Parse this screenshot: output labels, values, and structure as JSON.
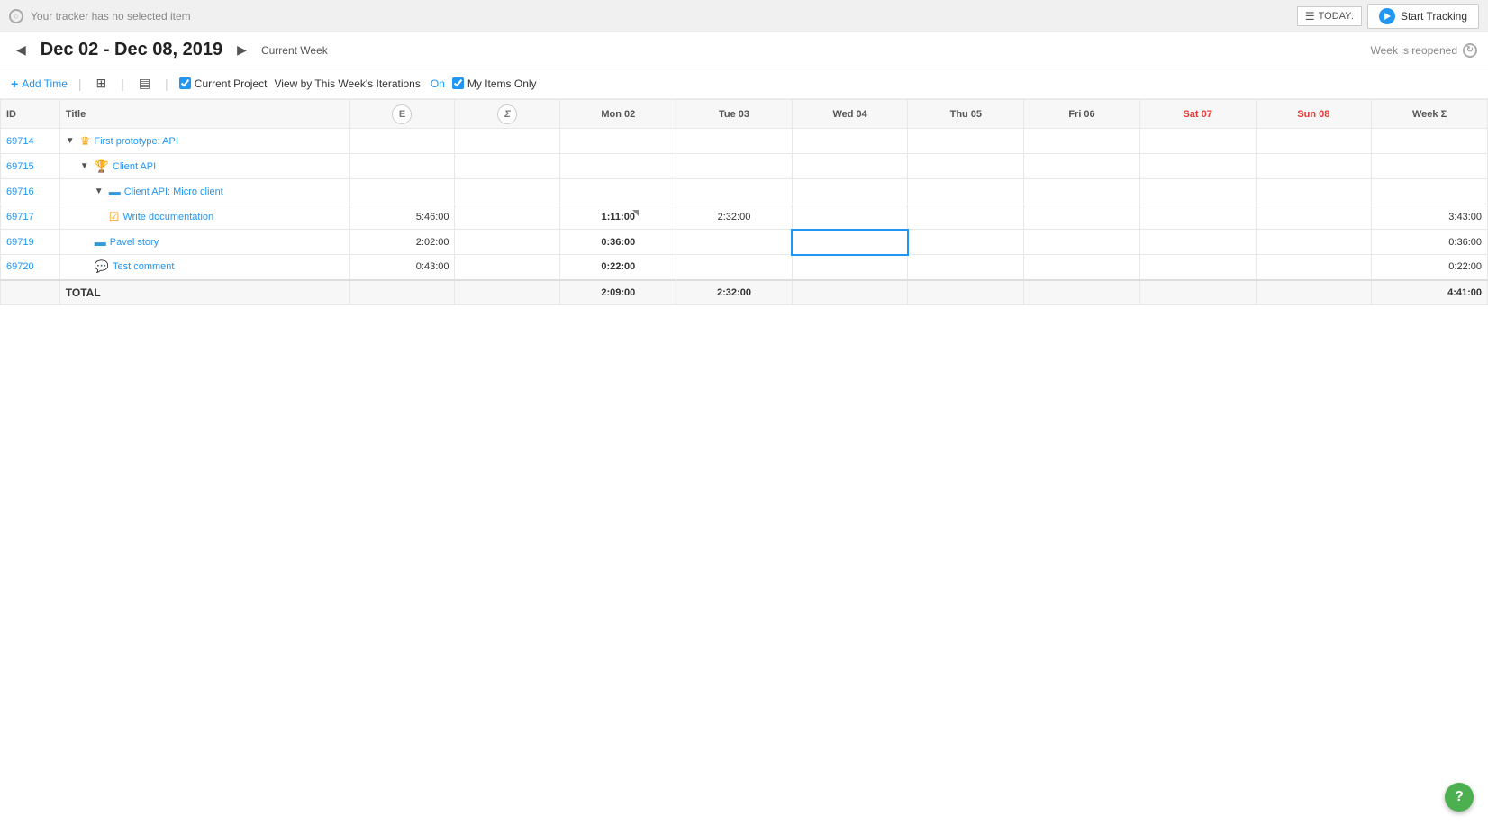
{
  "topBar": {
    "trackerMessage": "Your tracker has no selected item",
    "todayLabel": "TODAY:",
    "startTrackingLabel": "Start Tracking"
  },
  "weekNav": {
    "dateRange": "Dec 02 - Dec 08, 2019",
    "currentWeekLabel": "Current Week",
    "weekReopenedLabel": "Week is reopened"
  },
  "toolbar": {
    "addTimeLabel": "Add Time",
    "currentProjectLabel": "Current Project",
    "viewByLabel": "View by This Week's Iterations",
    "viewByOnLabel": "On",
    "myItemsOnlyLabel": "My Items Only"
  },
  "table": {
    "headers": {
      "id": "ID",
      "title": "Title",
      "e": "E",
      "sigma": "Σ",
      "mon": "Mon 02",
      "tue": "Tue 03",
      "wed": "Wed 04",
      "thu": "Thu 05",
      "fri": "Fri 06",
      "sat": "Sat 07",
      "sun": "Sun 08",
      "weekSigma": "Week Σ"
    },
    "rows": [
      {
        "id": "69714",
        "title": "First prototype: API",
        "icon": "crown",
        "indent": 0,
        "expanded": true,
        "e": "",
        "sigma": "",
        "mon": "",
        "tue": "",
        "wed": "",
        "thu": "",
        "fri": "",
        "sat": "",
        "sun": "",
        "weekSigma": ""
      },
      {
        "id": "69715",
        "title": "Client API",
        "icon": "trophy",
        "indent": 1,
        "expanded": true,
        "e": "",
        "sigma": "",
        "mon": "",
        "tue": "",
        "wed": "",
        "thu": "",
        "fri": "",
        "sat": "",
        "sun": "",
        "weekSigma": ""
      },
      {
        "id": "69716",
        "title": "Client API: Micro client",
        "icon": "story",
        "indent": 2,
        "expanded": true,
        "e": "",
        "sigma": "",
        "mon": "",
        "tue": "",
        "wed": "",
        "thu": "",
        "fri": "",
        "sat": "",
        "sun": "",
        "weekSigma": ""
      },
      {
        "id": "69717",
        "title": "Write documentation",
        "icon": "task",
        "indent": 3,
        "expanded": false,
        "e": "5:46:00",
        "sigma": "",
        "mon": "1:11:00",
        "monNote": true,
        "tue": "2:32:00",
        "wed": "",
        "thu": "",
        "fri": "",
        "sat": "",
        "sun": "",
        "weekSigma": "3:43:00"
      },
      {
        "id": "69719",
        "title": "Pavel story",
        "icon": "story",
        "indent": 2,
        "expanded": false,
        "e": "2:02:00",
        "sigma": "",
        "mon": "0:36:00",
        "monNote": false,
        "tue": "",
        "wed": "active",
        "thu": "",
        "fri": "",
        "sat": "",
        "sun": "",
        "weekSigma": "0:36:00"
      },
      {
        "id": "69720",
        "title": "Test comment",
        "icon": "comment",
        "indent": 2,
        "expanded": false,
        "e": "0:43:00",
        "sigma": "",
        "mon": "0:22:00",
        "monNote": false,
        "tue": "",
        "wed": "",
        "thu": "",
        "fri": "",
        "sat": "",
        "sun": "",
        "weekSigma": "0:22:00"
      }
    ],
    "totalRow": {
      "label": "TOTAL",
      "mon": "2:09:00",
      "tue": "2:32:00",
      "weekSigma": "4:41:00"
    }
  },
  "help": {
    "label": "?"
  }
}
